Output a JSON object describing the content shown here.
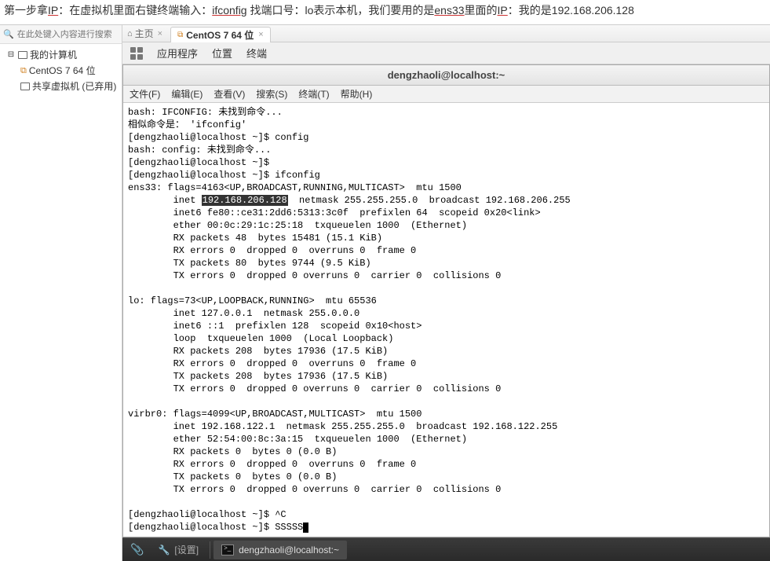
{
  "instruction": {
    "p1": "第一步拿",
    "ip": "IP",
    "p2": "：在虚拟机里面右键终端输入：",
    "cmd": "ifconfig",
    "p3": " 找端口号：lo表示本机，我们要用的是",
    "ens": "ens33",
    "p4": "里面的",
    "ip2": "IP",
    "p5": "：我的是192.168.206.128"
  },
  "sidebar_search_placeholder": "在此处键入内容进行搜索",
  "tree": {
    "root": "我的计算机",
    "vm1": "CentOS 7 64 位",
    "vm2": "共享虚拟机 (已弃用)"
  },
  "tabs": {
    "home": "主页",
    "active": "CentOS 7 64 位"
  },
  "gnome": {
    "apps": "应用程序",
    "places": "位置",
    "terminal": "终端"
  },
  "term_title": "dengzhaoli@localhost:~",
  "term_menu": {
    "file": "文件(F)",
    "edit": "编辑(E)",
    "view": "查看(V)",
    "search": "搜索(S)",
    "terminal": "终端(T)",
    "help": "帮助(H)"
  },
  "terminal_lines": {
    "l01": "bash: IFCONFIG: 未找到命令...",
    "l02": "相似命令是： 'ifconfig'",
    "l03": "[dengzhaoli@localhost ~]$ config",
    "l04": "bash: config: 未找到命令...",
    "l05": "[dengzhaoli@localhost ~]$",
    "l06": "[dengzhaoli@localhost ~]$ ifconfig",
    "l07a": "ens33: flags=4163<UP,BROADCAST,RUNNING,MULTICAST>  mtu 1500",
    "l08a": "        inet ",
    "l08sel": "192.168.206.128",
    "l08b": "  netmask 255.255.255.0  broadcast 192.168.206.255",
    "l09": "        inet6 fe80::ce31:2dd6:5313:3c0f  prefixlen 64  scopeid 0x20<link>",
    "l10": "        ether 00:0c:29:1c:25:18  txqueuelen 1000  (Ethernet)",
    "l11": "        RX packets 48  bytes 15481 (15.1 KiB)",
    "l12": "        RX errors 0  dropped 0  overruns 0  frame 0",
    "l13": "        TX packets 80  bytes 9744 (9.5 KiB)",
    "l14": "        TX errors 0  dropped 0 overruns 0  carrier 0  collisions 0",
    "l15": "",
    "l16": "lo: flags=73<UP,LOOPBACK,RUNNING>  mtu 65536",
    "l17": "        inet 127.0.0.1  netmask 255.0.0.0",
    "l18": "        inet6 ::1  prefixlen 128  scopeid 0x10<host>",
    "l19": "        loop  txqueuelen 1000  (Local Loopback)",
    "l20": "        RX packets 208  bytes 17936 (17.5 KiB)",
    "l21": "        RX errors 0  dropped 0  overruns 0  frame 0",
    "l22": "        TX packets 208  bytes 17936 (17.5 KiB)",
    "l23": "        TX errors 0  dropped 0 overruns 0  carrier 0  collisions 0",
    "l24": "",
    "l25": "virbr0: flags=4099<UP,BROADCAST,MULTICAST>  mtu 1500",
    "l26": "        inet 192.168.122.1  netmask 255.255.255.0  broadcast 192.168.122.255",
    "l27": "        ether 52:54:00:8c:3a:15  txqueuelen 1000  (Ethernet)",
    "l28": "        RX packets 0  bytes 0 (0.0 B)",
    "l29": "        RX errors 0  dropped 0  overruns 0  frame 0",
    "l30": "        TX packets 0  bytes 0 (0.0 B)",
    "l31": "        TX errors 0  dropped 0 overruns 0  carrier 0  collisions 0",
    "l32": "",
    "l33": "[dengzhaoli@localhost ~]$ ^C",
    "l34": "[dengzhaoli@localhost ~]$ SSSSS"
  },
  "taskbar": {
    "settings": "[设置]",
    "terminal": "dengzhaoli@localhost:~"
  }
}
